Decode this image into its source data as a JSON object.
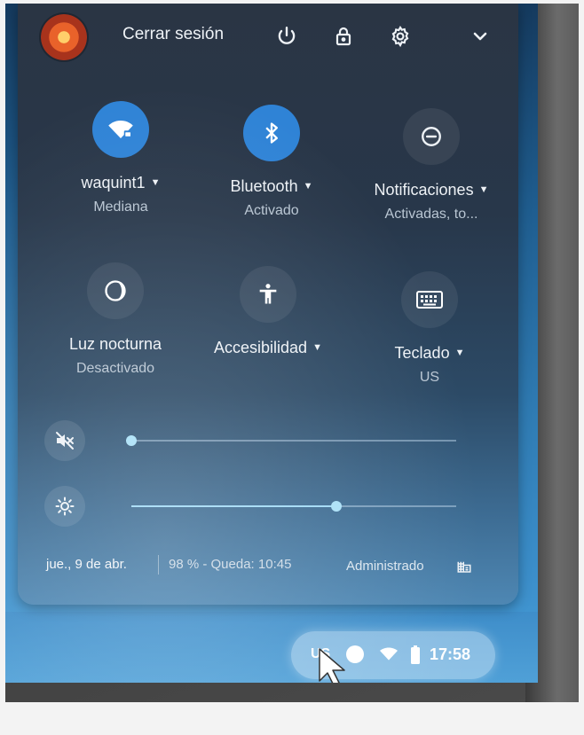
{
  "header": {
    "signout_label": "Cerrar sesión",
    "icons": [
      "power-icon",
      "lock-icon",
      "gear-icon",
      "chevron-down-icon"
    ]
  },
  "tiles": [
    {
      "label": "waquint1",
      "sub": "Mediana",
      "icon": "wifi-icon",
      "state": "on"
    },
    {
      "label": "Bluetooth",
      "sub": "Activado",
      "icon": "bluetooth-icon",
      "state": "on"
    },
    {
      "label": "Notificaciones",
      "sub": "Activadas, to...",
      "icon": "do-not-disturb-icon",
      "state": "off"
    },
    {
      "label": "Luz nocturna",
      "sub": "Desactivado",
      "icon": "night-light-icon",
      "state": "off"
    },
    {
      "label": "Accesibilidad",
      "sub": "",
      "icon": "accessibility-icon",
      "state": "off"
    },
    {
      "label": "Teclado",
      "sub": "US",
      "icon": "keyboard-icon",
      "state": "off"
    }
  ],
  "sliders": {
    "volume": {
      "icon": "volume-muted-icon",
      "value": 0
    },
    "brightness": {
      "icon": "brightness-icon",
      "value": 0.63
    }
  },
  "footer": {
    "date": "jue., 9 de abr.",
    "battery": "98 % - Queda: 10:45",
    "managed": "Administrado"
  },
  "shelf": {
    "ime": "US",
    "time": "17:58"
  },
  "colors": {
    "accent": "#2f83d6",
    "panel_top": "#2a3544",
    "wallpaper": "#2f7bb3"
  }
}
